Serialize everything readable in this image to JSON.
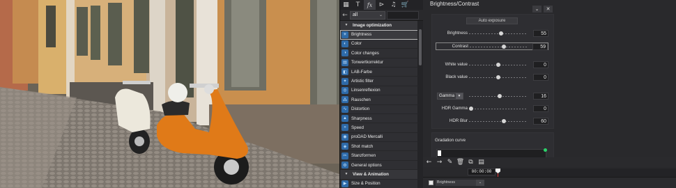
{
  "effects_panel": {
    "filter": {
      "selected": "all"
    },
    "toolbar_icons": [
      "grid-icon",
      "text-icon",
      "fx-icon",
      "transition-icon",
      "music-icon",
      "cart-icon"
    ],
    "items": [
      {
        "type": "header",
        "label": "Image optimization"
      },
      {
        "type": "item",
        "label": "Brightness",
        "selected": true
      },
      {
        "type": "item",
        "label": "Color"
      },
      {
        "type": "item",
        "label": "Color changes"
      },
      {
        "type": "item",
        "label": "Tonwertkorrektur"
      },
      {
        "type": "item",
        "label": "LAB-Farbe"
      },
      {
        "type": "item",
        "label": "Artistic filter"
      },
      {
        "type": "item",
        "label": "Linsenreflexion"
      },
      {
        "type": "item",
        "label": "Rauschen"
      },
      {
        "type": "item",
        "label": "Distortion"
      },
      {
        "type": "item",
        "label": "Sharpness"
      },
      {
        "type": "item",
        "label": "Speed"
      },
      {
        "type": "item",
        "label": "proDAD Mercalli"
      },
      {
        "type": "item",
        "label": "Shot match"
      },
      {
        "type": "item",
        "label": "Stanzformen"
      },
      {
        "type": "item",
        "label": "General options"
      },
      {
        "type": "header",
        "label": "View & Animation"
      },
      {
        "type": "item",
        "label": "Size & Position"
      }
    ]
  },
  "properties": {
    "title": "Brightness/Contrast",
    "auto_exposure_label": "Auto exposure",
    "brightness": {
      "label": "Brightness",
      "value": "55",
      "level": 0.55
    },
    "contrast": {
      "label": "Contrast",
      "value": "59",
      "level": 0.59
    },
    "white_value": {
      "label": "White value",
      "value": "0",
      "level": 0.5
    },
    "black_value": {
      "label": "Black value",
      "value": "0",
      "level": 0.5
    },
    "gamma": {
      "label": "Gamma",
      "value": "16",
      "level": 0.52
    },
    "hdr_gamma": {
      "label": "HDR Gamma",
      "value": "0",
      "level": 0.0
    },
    "hdr_blur": {
      "label": "HDR Blur",
      "value": "60",
      "level": 0.6
    },
    "gradation_label": "Gradation curve"
  },
  "timeline": {
    "timecode": "00:00:00",
    "track_label": "Brightness"
  },
  "colors": {
    "accent_blue": "#2e6aa8",
    "playhead_red": "#dd3333",
    "curve_green": "#2bd36a"
  }
}
